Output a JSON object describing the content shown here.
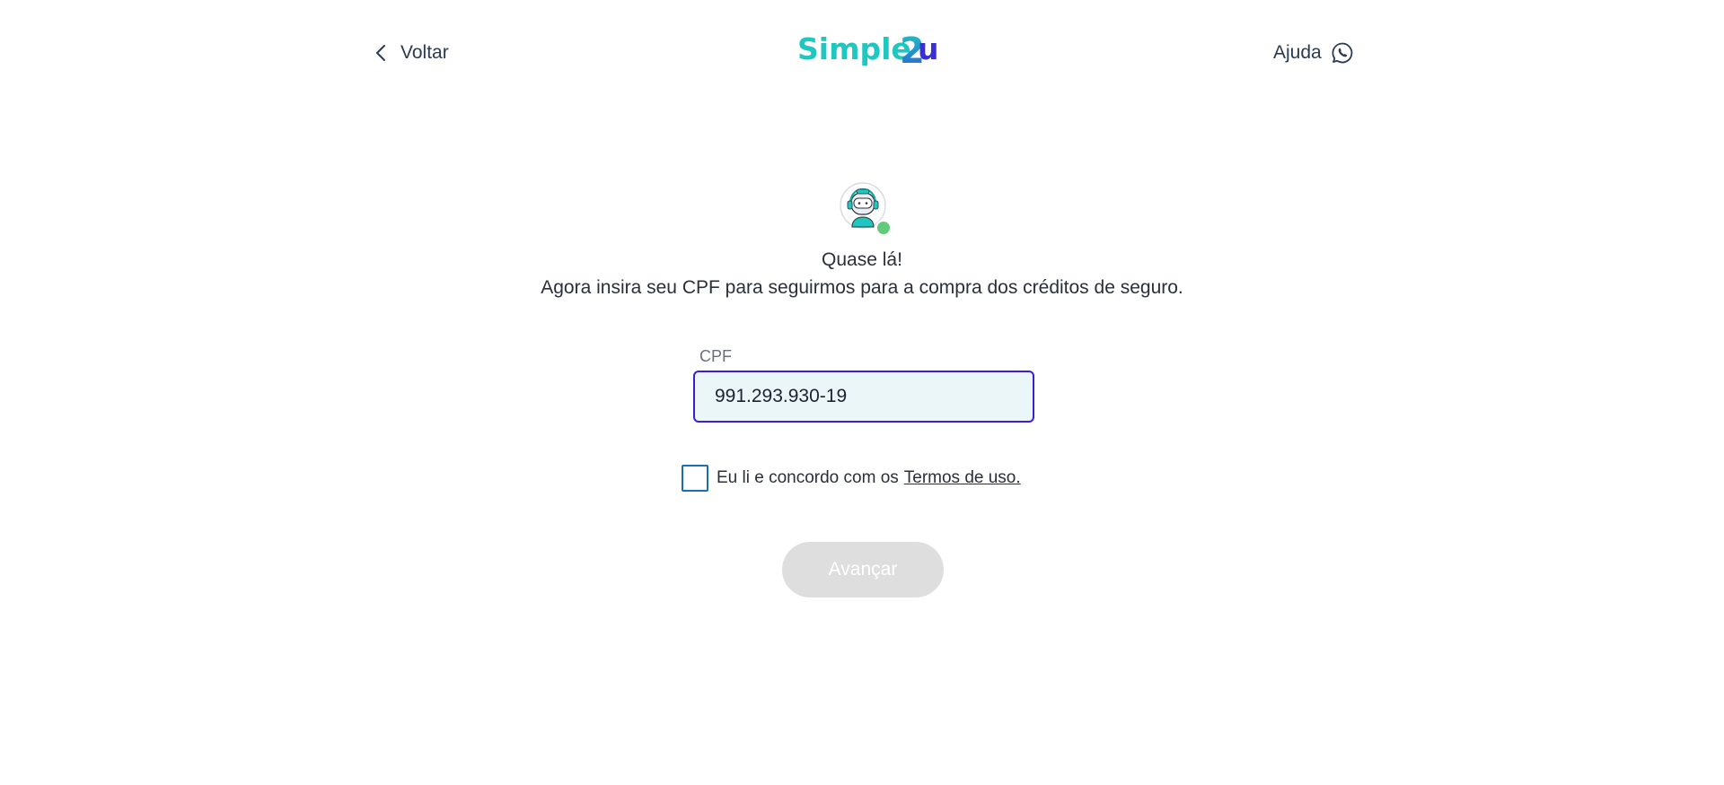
{
  "header": {
    "back_label": "Voltar",
    "logo": {
      "text_simple": "Simple",
      "text_2": "2",
      "text_u": "u"
    },
    "help_label": "Ajuda",
    "help_icon": "whatsapp-icon",
    "back_icon": "chevron-left-icon"
  },
  "hero": {
    "avatar_icon": "robot-assistant-icon",
    "status": "online",
    "title": "Quase lá!",
    "subtitle": "Agora insira seu CPF para seguirmos para a compra dos créditos de seguro."
  },
  "form": {
    "cpf_label": "CPF",
    "cpf_value": "991.293.930-19",
    "terms_checked": false,
    "terms_text": "Eu li e concordo com os",
    "terms_link": "Termos de uso.",
    "next_label": "Avançar",
    "next_enabled": false
  },
  "colors": {
    "brand_teal": "#1fc7c1",
    "brand_blue": "#2a5fd6",
    "input_border": "#3a1ed6",
    "input_bg": "#eaf6f8",
    "button_disabled": "#dedede",
    "status_green": "#63c97b"
  }
}
